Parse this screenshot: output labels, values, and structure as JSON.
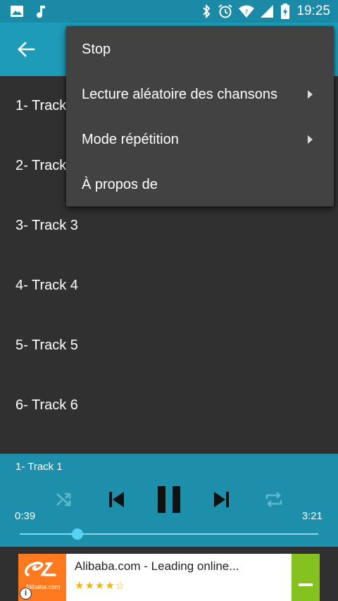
{
  "status_bar": {
    "time": "19:25",
    "icons": [
      "image-icon",
      "music-note-icon",
      "bluetooth-icon",
      "alarm-icon",
      "wifi-icon",
      "cell-signal-icon",
      "battery-charging-icon"
    ]
  },
  "app_bar": {
    "back_icon": "arrow-left-icon"
  },
  "tracks": [
    "1- Track 1",
    "2- Track 2",
    "3- Track 3",
    "4- Track 4",
    "5- Track 5",
    "6- Track 6"
  ],
  "menu": {
    "items": [
      {
        "label": "Stop",
        "submenu": false
      },
      {
        "label": "Lecture aléatoire des chansons",
        "submenu": true
      },
      {
        "label": "Mode répétition",
        "submenu": true
      },
      {
        "label": "À propos de",
        "submenu": false
      }
    ]
  },
  "player": {
    "now_playing": "1- Track 1",
    "elapsed": "0:39",
    "total": "3:21",
    "progress_fraction": 0.194,
    "controls": [
      "shuffle-icon",
      "skip-previous-icon",
      "pause-icon",
      "skip-next-icon",
      "repeat-icon"
    ]
  },
  "ad": {
    "title": "Alibaba.com - Leading online...",
    "logo_text": "Alibaba.com",
    "stars": "★★★★☆",
    "info": "i"
  },
  "colors": {
    "status_bar": "#1a8aa6",
    "app_bar": "#1d9bb8",
    "background": "#303030",
    "menu": "#424242",
    "player": "#1d8fab",
    "seek_accent": "#57d3f2",
    "ad_cta": "#86c21f"
  }
}
